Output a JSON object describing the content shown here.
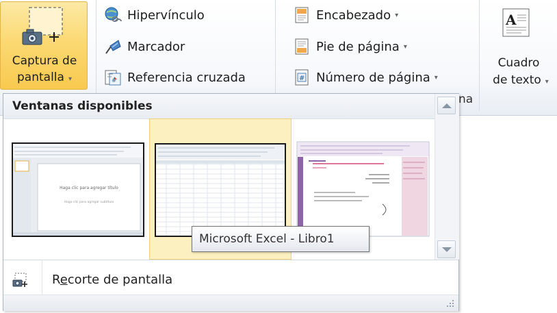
{
  "ribbon": {
    "screenshot_button": {
      "label_line1": "Captura de",
      "label_line2": "pantalla",
      "icon": "screenshot-camera-icon"
    },
    "links_group": [
      {
        "label": "Hipervínculo",
        "icon": "hyperlink-globe-icon"
      },
      {
        "label": "Marcador",
        "icon": "bookmark-flag-icon"
      },
      {
        "label": "Referencia cruzada",
        "icon": "cross-reference-icon"
      }
    ],
    "header_footer_group": [
      {
        "label": "Encabezado",
        "icon": "header-page-icon"
      },
      {
        "label": "Pie de página",
        "icon": "footer-page-icon"
      },
      {
        "label": "Número de página",
        "icon": "page-number-icon"
      }
    ],
    "header_footer_group_name_fragment": "na",
    "text_box": {
      "label_line1": "Cuadro",
      "label_line2": "de texto",
      "icon": "text-box-icon"
    },
    "dropdown_caret": "▾"
  },
  "gallery": {
    "title": "Ventanas disponibles",
    "windows": [
      {
        "app": "powerpoint",
        "slide_title": "Haga clic para agregar título",
        "slide_subtitle": "Haga clic para agregar subtítulo"
      },
      {
        "app": "excel",
        "selected": true
      },
      {
        "app": "onenote"
      }
    ],
    "tooltip": "Microsoft Excel - Libro1",
    "clip_item": {
      "label_before": "R",
      "label_underlined": "e",
      "label_after": "corte de pantalla",
      "icon": "screen-clipping-icon"
    }
  },
  "colors": {
    "selected_fill": "#fbd973",
    "selected_border": "#e3b343",
    "hover_fill": "#fdf0c0"
  }
}
